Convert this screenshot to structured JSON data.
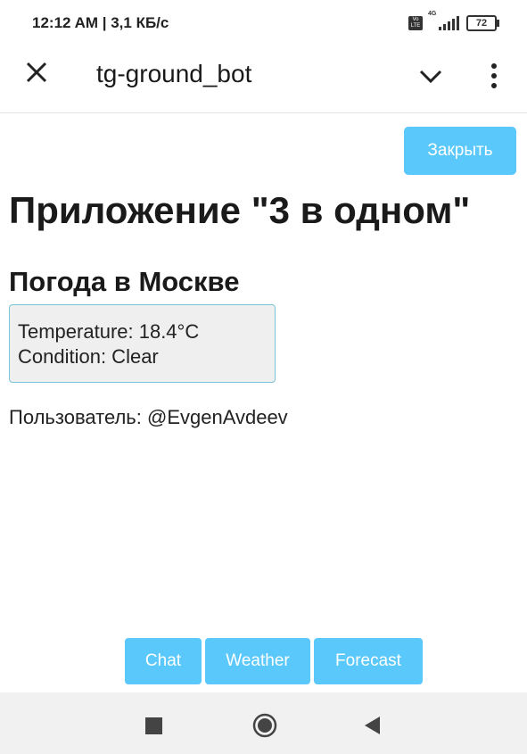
{
  "status_bar": {
    "time_speed": "12:12 AM | 3,1 КБ/с",
    "volte_top": "Vo",
    "volte_bottom": "LTE",
    "network": "4G",
    "battery": "72"
  },
  "header": {
    "title": "tg-ground_bot",
    "close_icon": "close-x-icon",
    "chevron_icon": "chevron-down-icon",
    "more_icon": "more-vertical-icon"
  },
  "main": {
    "close_button": "Закрыть",
    "app_title": "Приложение \"3 в одном\"",
    "weather_heading": "Погода в Москве",
    "temperature_line": "Temperature: 18.4°C",
    "condition_line": "Condition: Clear",
    "user_line": "Пользователь: @EvgenAvdeev"
  },
  "bottom_buttons": {
    "chat": "Chat",
    "weather": "Weather",
    "forecast": "Forecast"
  },
  "nav": {
    "recents_icon": "square-icon",
    "home_icon": "circle-home-icon",
    "back_icon": "triangle-back-icon"
  },
  "colors": {
    "button_bg": "#5ac8fa",
    "box_border": "#79c6d6",
    "box_bg": "#efefef"
  }
}
